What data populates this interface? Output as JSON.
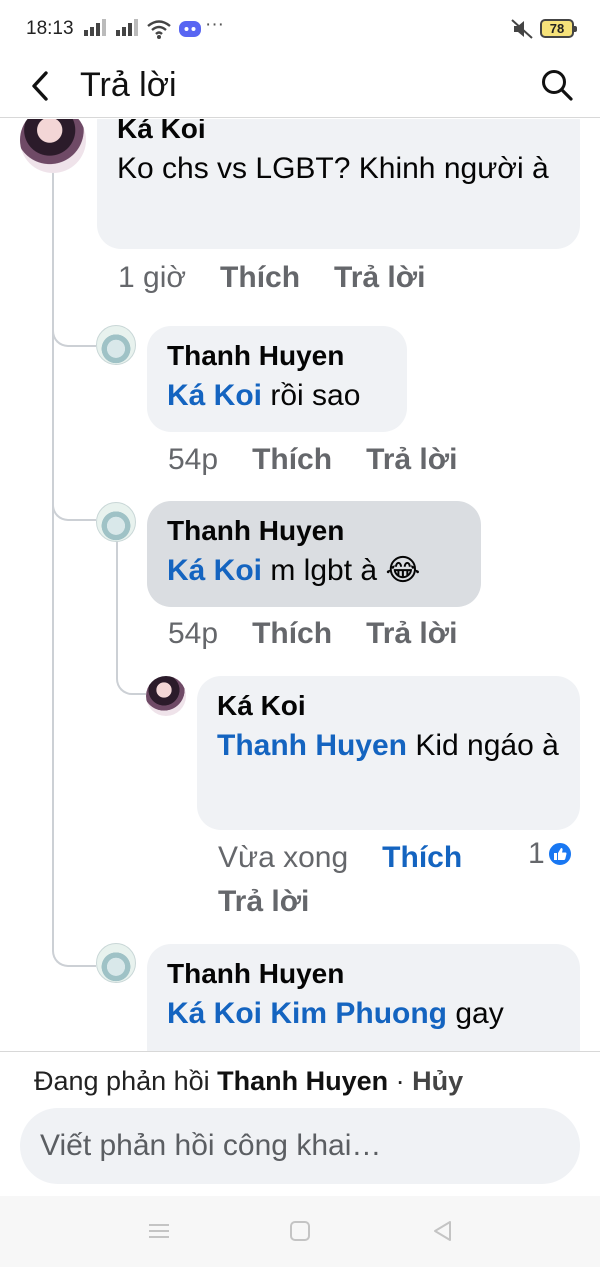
{
  "status_bar": {
    "time": "18:13",
    "dots": "···",
    "battery": "78",
    "icons": [
      "signal-icon",
      "signal-icon",
      "wifi-icon",
      "discord-icon",
      "mute-icon",
      "battery-icon"
    ]
  },
  "header": {
    "title": "Trả lời",
    "icons": [
      "back-arrow-icon",
      "search-icon"
    ]
  },
  "comments": [
    {
      "author": "Ká Koi",
      "text": "Ko chs vs LGBT? Khinh người à",
      "time": "1 giờ",
      "like_label": "Thích",
      "reply_label": "Trả lời"
    },
    {
      "author": "Thanh Huyen",
      "mention": "Ká Koi",
      "text": " rồi sao",
      "time": "54p",
      "like_label": "Thích",
      "reply_label": "Trả lời"
    },
    {
      "author": "Thanh Huyen",
      "mention": "Ká Koi",
      "text": " m lgbt à ",
      "emoji": "😂",
      "time": "54p",
      "like_label": "Thích",
      "reply_label": "Trả lời"
    },
    {
      "author": "Ká Koi",
      "mention": "Thanh Huyen",
      "text": " Kid ngáo à",
      "time": "Vừa xong",
      "like_label": "Thích",
      "reply_label": "Trả lời",
      "reaction_count": "1",
      "liked": true
    },
    {
      "author": "Thanh Huyen",
      "mention": "Ká Koi Kim Phuong",
      "text": " gay"
    }
  ],
  "reply_bar": {
    "prefix": "Đang phản hồi ",
    "target": "Thanh Huyen",
    "separator": " · ",
    "cancel": "Hủy",
    "placeholder": "Viết phản hồi công khai…"
  },
  "colors": {
    "mention": "#1464c0",
    "bubble": "#f0f2f5",
    "bubble_highlight": "#dadde1",
    "meta": "#65676b",
    "like_badge": "#1877f2"
  }
}
